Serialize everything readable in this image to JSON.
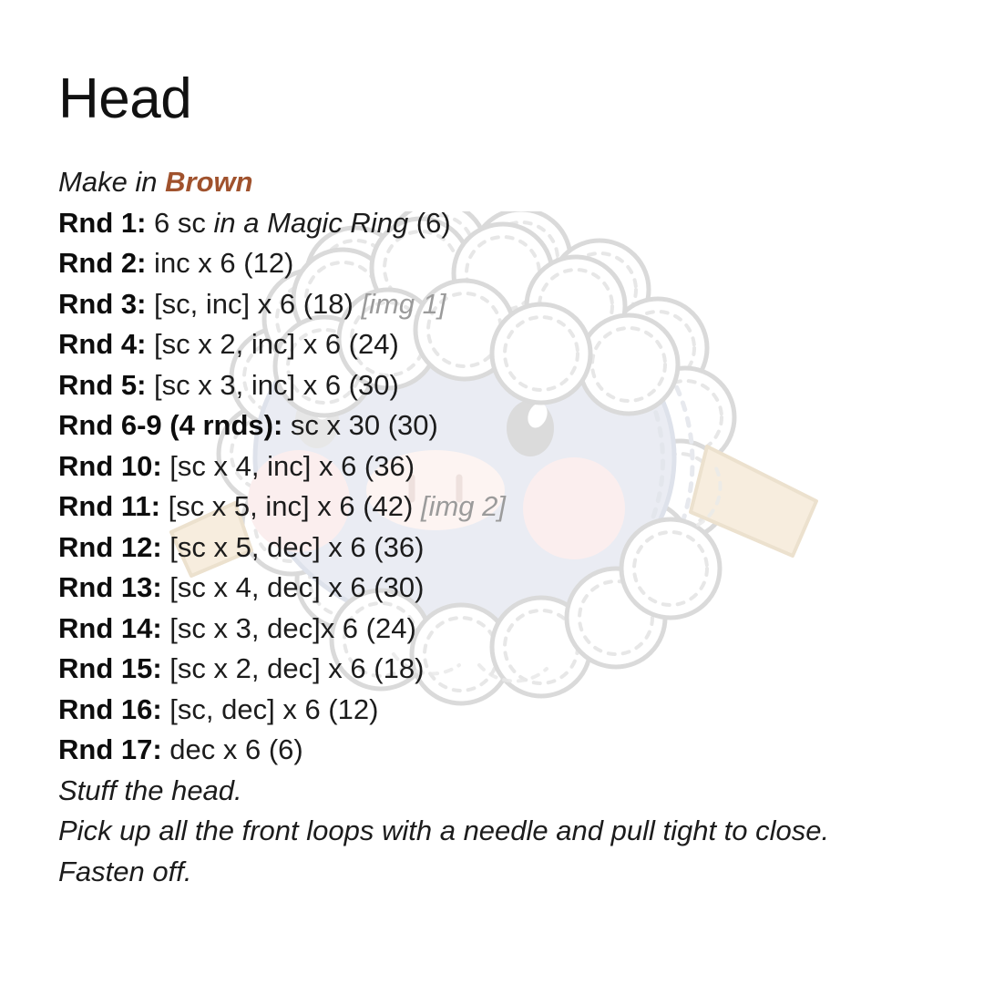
{
  "page": {
    "title": "Head",
    "background_color": "#ffffff",
    "text_color": "#1c1c1c",
    "accent_color": "#a0522d",
    "muted_color": "#9b9b9b"
  },
  "make_line": {
    "prefix": "Make in ",
    "color_name": "Brown"
  },
  "rounds": [
    {
      "label": "Rnd 1:",
      "pre": " 6 sc ",
      "italic": "in a Magic Ring",
      "post": " (6)",
      "img_ref": ""
    },
    {
      "label": "Rnd 2:",
      "pre": " inc x 6 (12)",
      "italic": "",
      "post": "",
      "img_ref": ""
    },
    {
      "label": "Rnd 3:",
      "pre": " [sc, inc] x 6 (18) ",
      "italic": "",
      "post": "",
      "img_ref": "[img 1]"
    },
    {
      "label": "Rnd 4:",
      "pre": " [sc x 2, inc] x 6 (24)",
      "italic": "",
      "post": "",
      "img_ref": ""
    },
    {
      "label": "Rnd 5:",
      "pre": " [sc x 3, inc] x 6 (30)",
      "italic": "",
      "post": "",
      "img_ref": ""
    },
    {
      "label": "Rnd 6-9 (4 rnds):",
      "pre": " sc x 30 (30)",
      "italic": "",
      "post": "",
      "img_ref": ""
    },
    {
      "label": "Rnd 10:",
      "pre": " [sc x 4, inc] x 6 (36)",
      "italic": "",
      "post": "",
      "img_ref": ""
    },
    {
      "label": "Rnd 11:",
      "pre": " [sc x 5, inc] x 6 (42) ",
      "italic": "",
      "post": "",
      "img_ref": "[img 2]"
    },
    {
      "label": "Rnd 12:",
      "pre": " [sc x 5, dec] x 6 (36)",
      "italic": "",
      "post": "",
      "img_ref": ""
    },
    {
      "label": "Rnd 13:",
      "pre": " [sc x 4, dec] x 6 (30)",
      "italic": "",
      "post": "",
      "img_ref": ""
    },
    {
      "label": "Rnd 14:",
      "pre": " [sc x 3, dec]x 6 (24)",
      "italic": "",
      "post": "",
      "img_ref": ""
    },
    {
      "label": "Rnd 15:",
      "pre": " [sc x 2, dec] x 6 (18)",
      "italic": "",
      "post": "",
      "img_ref": ""
    },
    {
      "label": "Rnd 16:",
      "pre": " [sc, dec] x 6 (12)",
      "italic": "",
      "post": "",
      "img_ref": ""
    },
    {
      "label": "Rnd 17:",
      "pre": " dec x 6 (6)",
      "italic": "",
      "post": "",
      "img_ref": ""
    }
  ],
  "closing_notes": [
    "Stuff the head.",
    "Pick up all the front loops with a needle and pull tight to close.",
    "Fasten off."
  ],
  "illustration": {
    "name": "sheep-watermark",
    "wool_fill": "#ffffff",
    "wool_outline": "#d8d8d8",
    "stitch_dash": "#e4e4e4",
    "face_fill": "#e9ecf3",
    "face_outline": "#dbdfe9",
    "eye_fill": "#d9d9d9",
    "eye_highlight": "#ffffff",
    "cheek_fill": "#fbeeee",
    "ear_fill": "#f7eddd",
    "ear_outline": "#ece0cc"
  }
}
